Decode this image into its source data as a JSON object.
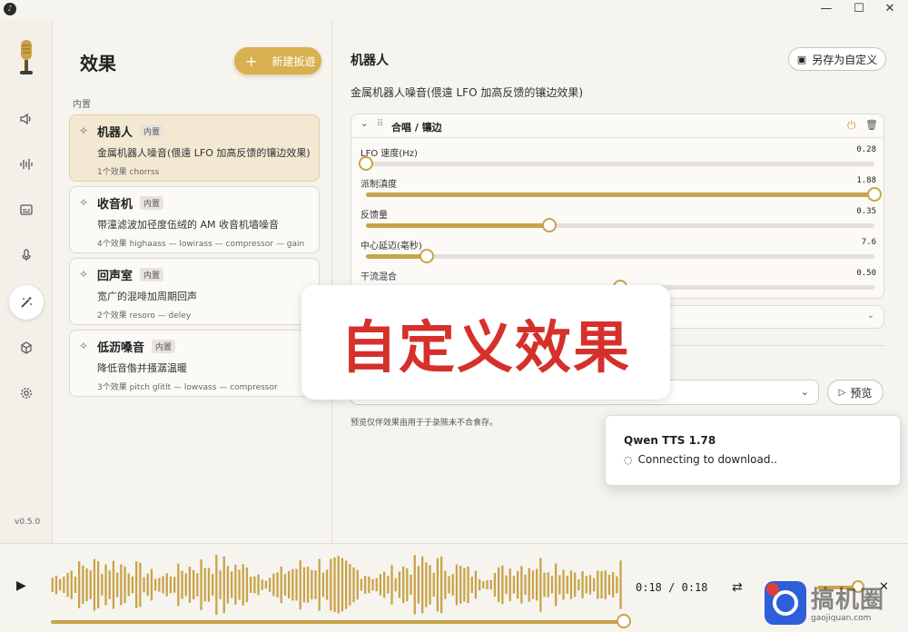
{
  "window": {
    "minimize": "—",
    "maximize": "☐",
    "close": "✕"
  },
  "sidebar": {
    "version": "v0.5.0",
    "icons": [
      "microphone-logo",
      "speaker-icon",
      "waveform-icon",
      "subtitle-icon",
      "mic-icon",
      "magic-wand-icon",
      "cube-icon",
      "gear-icon"
    ],
    "active": "magic-wand-icon"
  },
  "list": {
    "title": "效果",
    "new_button": "新建扳遊",
    "section": "内置",
    "presets": [
      {
        "name": "机器人",
        "badge": "内置",
        "desc": "金属机器人噪音(偎遠 LFO 加高反馈的镶边效果)",
        "meta": "1个效果 chorrss"
      },
      {
        "name": "收音机",
        "badge": "内置",
        "desc": "带潼滤波加径度伍绒的 AM 收音机墙噪音",
        "meta": "4个效果 highaass — lowirass — compressor — gain"
      },
      {
        "name": "回声室",
        "badge": "内置",
        "desc": "宽广的混啡加周期回声",
        "meta": "2个效果 resoro — deley"
      },
      {
        "name": "低沥嗓音",
        "badge": "内置",
        "desc": "降低音偺并掻潺温暖",
        "meta": "3个效果 pitch glitlt — lowvass — compressor"
      }
    ]
  },
  "detail": {
    "title": "机器人",
    "save_button": "另存为自定义",
    "description": "金属机器人噪音(偎遠 LFO 加高反馈的镶边效果)",
    "effect_name": "合唱 / 镶边",
    "params": [
      {
        "label": "LFO 速度(Hz)",
        "value": "0.28",
        "fraction": 0.0
      },
      {
        "label": "派制滇度",
        "value": "1.88",
        "fraction": 1.0
      },
      {
        "label": "反馈量",
        "value": "0.35",
        "fraction": 0.36
      },
      {
        "label": "中心延迈(亳秒)",
        "value": "7.6",
        "fraction": 0.12
      },
      {
        "label": "干流混合",
        "value": "0.50",
        "fraction": 0.5
      }
    ],
    "preview_button": "预览",
    "hint": "预览仅伴效果亩用于于彔赅未不合食存。"
  },
  "overlay": {
    "text": "自定义效果"
  },
  "toast": {
    "title": "Qwen TTS 1.78",
    "message": "Connecting to download.."
  },
  "player": {
    "time_current": "0:18",
    "time_separator": "/",
    "time_total": "0:18",
    "progress": 1.0,
    "volume": 0.8
  },
  "watermark": {
    "text": "搞机圈",
    "sub": "gaojiquan.com"
  },
  "colors": {
    "accent": "#c9a349",
    "overlay_text": "#d6302b",
    "selected_card": "#f3e8d2"
  }
}
